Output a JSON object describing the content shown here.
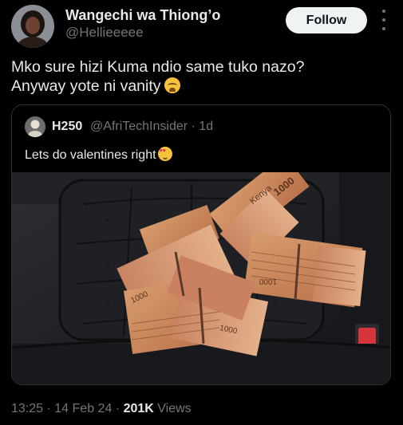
{
  "author": {
    "display_name": "Wangechi wa Thiong’o",
    "handle": "@Hellieeeee"
  },
  "follow_label": "Follow",
  "post": {
    "line1": "Mko sure hizi Kuma ndio same tuko nazo?",
    "line2": "Anyway yote ni vanity",
    "emoji": "loudly-crying-face"
  },
  "quoted": {
    "display_name": "H250",
    "handle": "@AfriTechInsider",
    "time": "· 1d",
    "text": "Lets do valentines right",
    "emoji": "smiling-face-with-heart-eyes",
    "photo_labels": {
      "bundle_a": "1000",
      "bundle_b": "1000",
      "bundle_c": "1000",
      "bundle_d": "1000",
      "kenya": "Kenya"
    }
  },
  "meta": {
    "time": "13:25",
    "date": "14 Feb 24",
    "views_count": "201K",
    "views_label": "Views"
  },
  "colors": {
    "background": "#000000",
    "text_primary": "#e7e9ea",
    "text_secondary": "#71767b",
    "border": "#2f3336",
    "follow_bg": "#eff3f4",
    "note_color": "#c98a5a"
  }
}
